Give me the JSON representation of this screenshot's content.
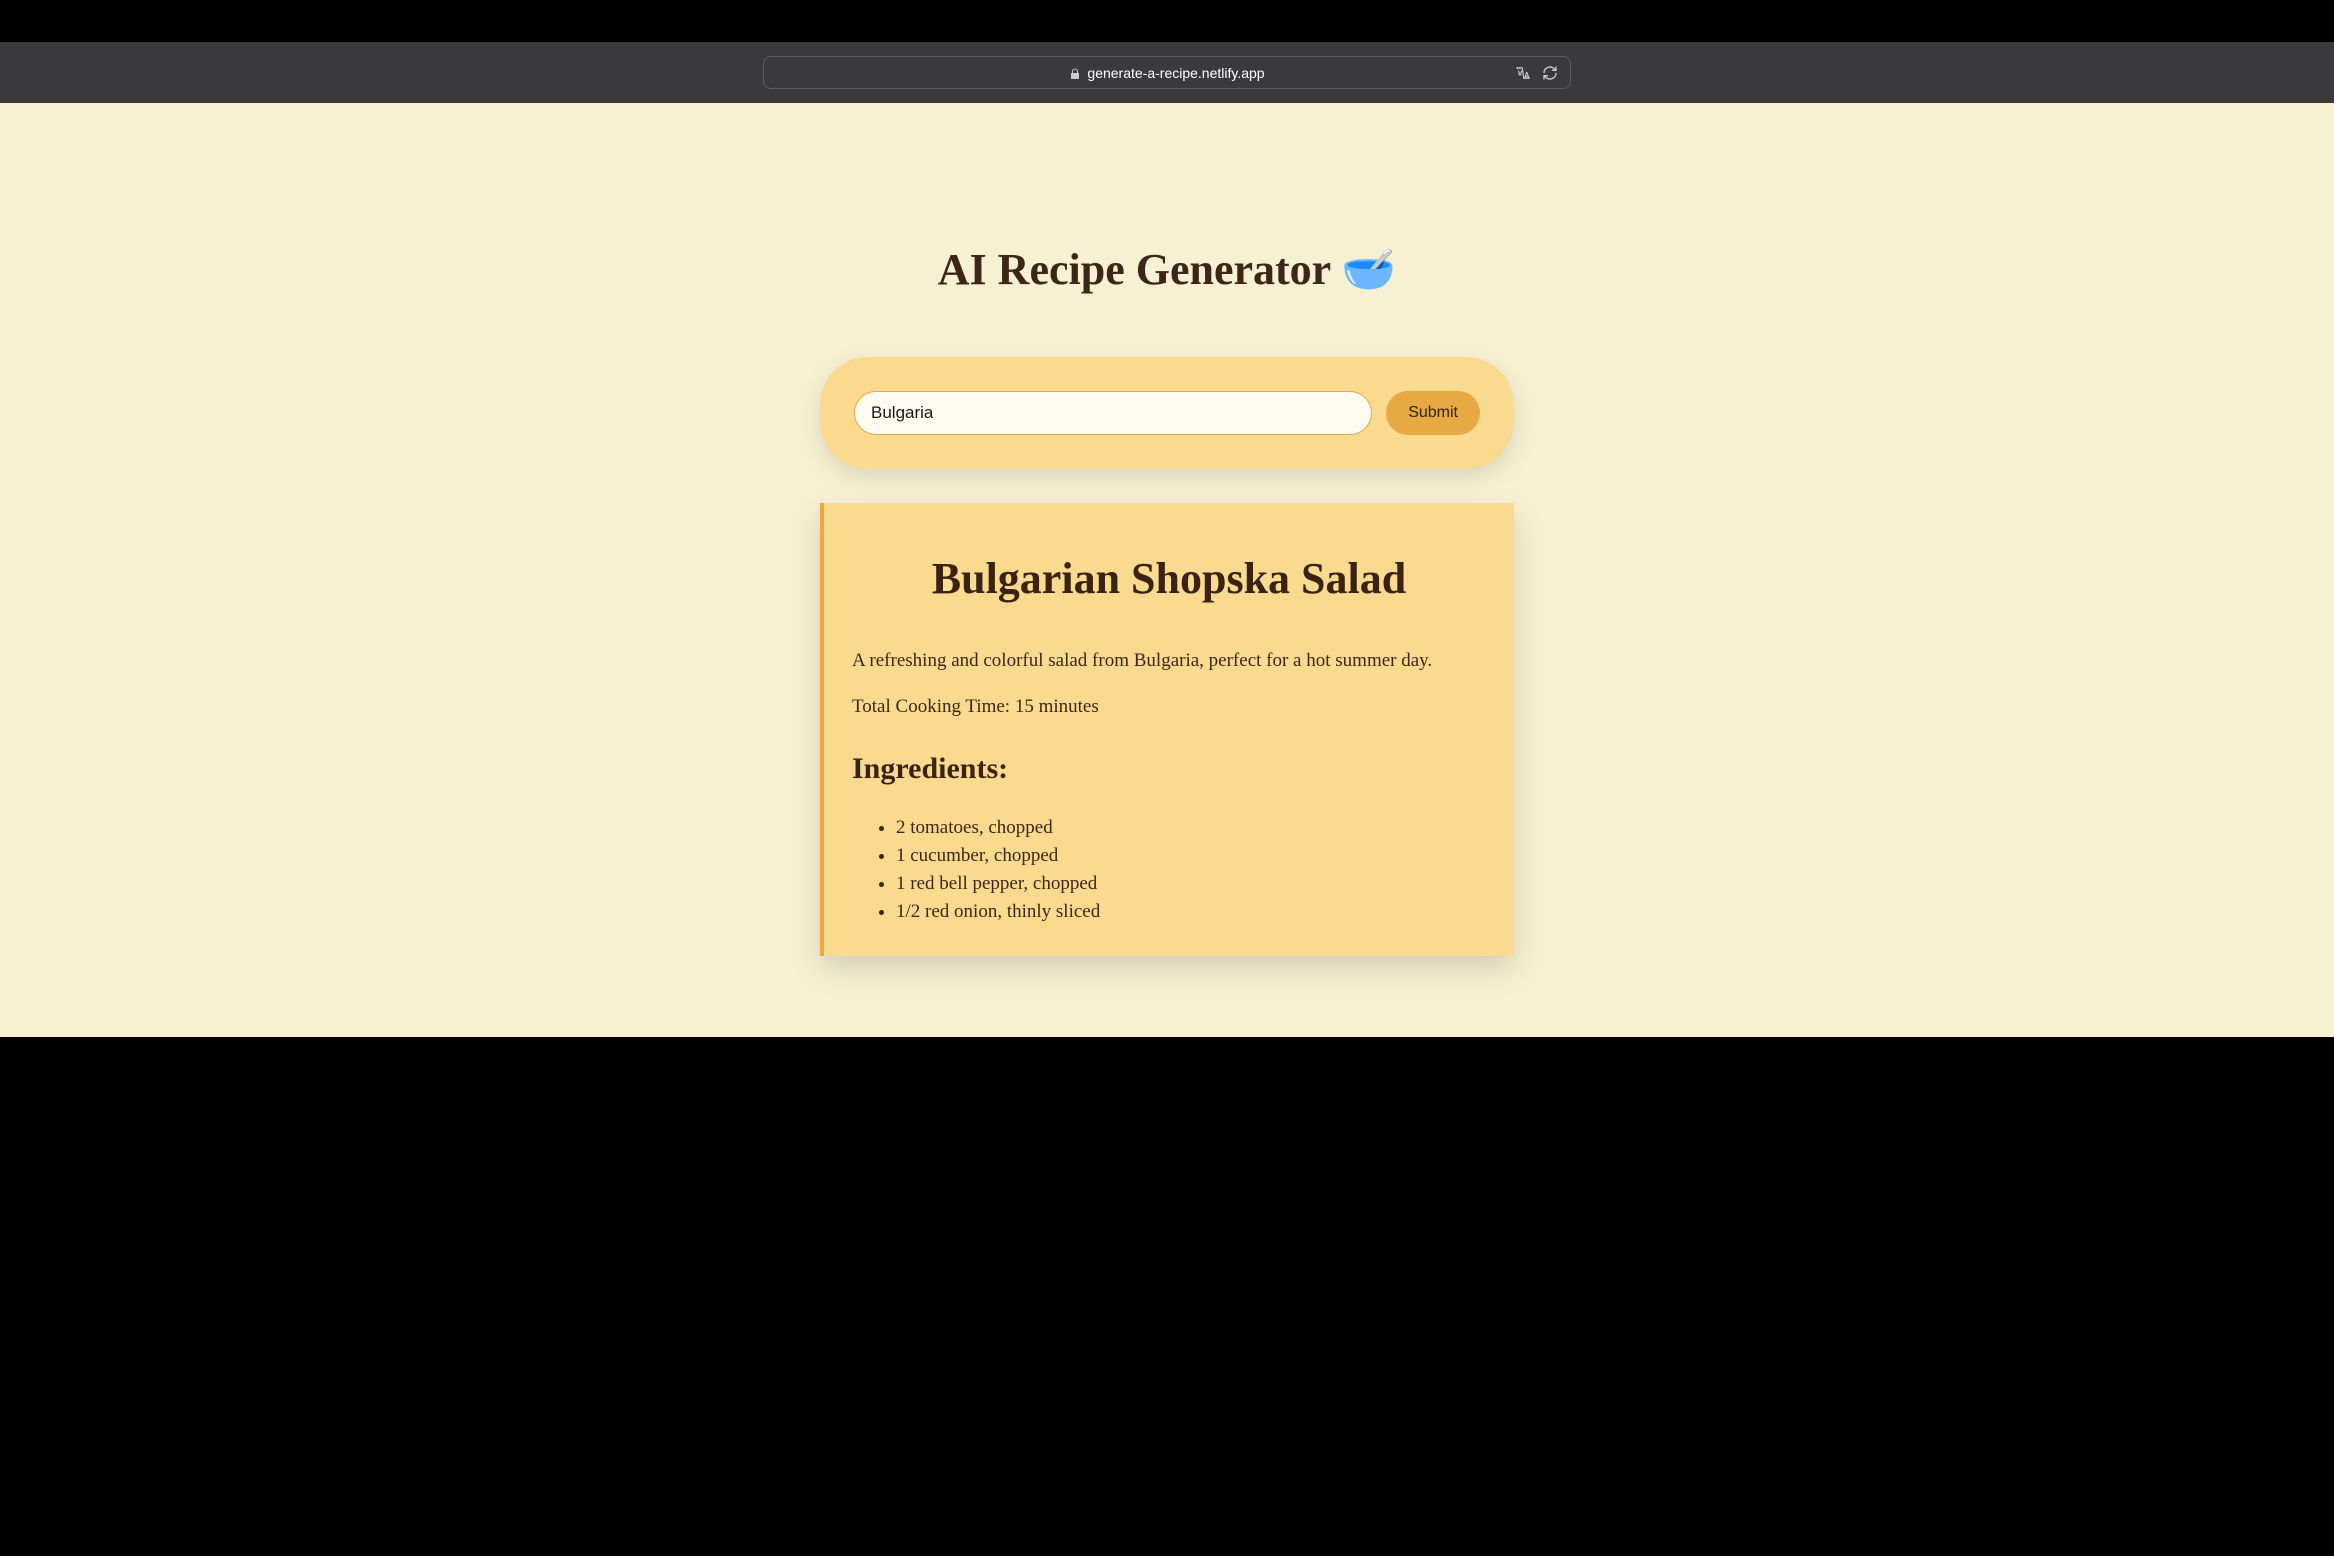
{
  "browser": {
    "url": "generate-a-recipe.netlify.app"
  },
  "page": {
    "title": "AI Recipe Generator 🥣"
  },
  "form": {
    "input_value": "Bulgaria",
    "submit_label": "Submit"
  },
  "recipe": {
    "title": "Bulgarian Shopska Salad",
    "description": "A refreshing and colorful salad from Bulgaria, perfect for a hot summer day.",
    "cooking_time": "Total Cooking Time: 15 minutes",
    "ingredients_heading": "Ingredients:",
    "ingredients": [
      "2 tomatoes, chopped",
      "1 cucumber, chopped",
      "1 red bell pepper, chopped",
      "1/2 red onion, thinly sliced"
    ]
  }
}
